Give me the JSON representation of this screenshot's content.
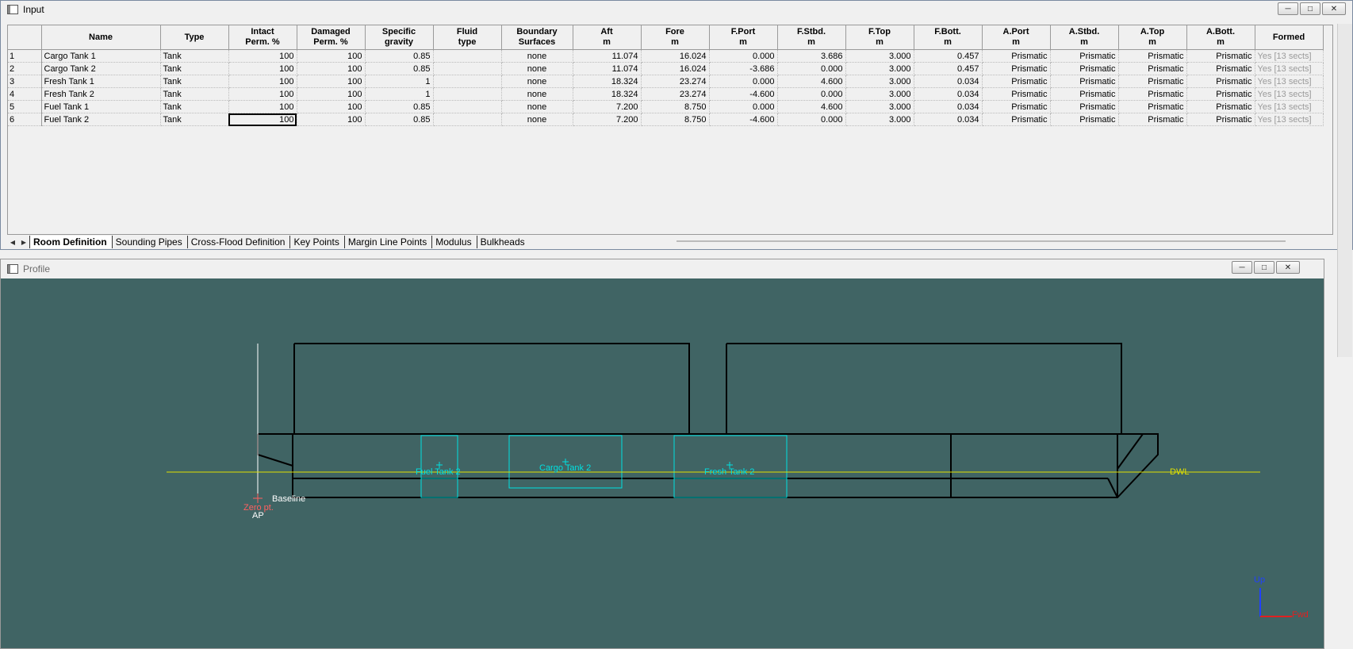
{
  "input_window": {
    "title": "Input"
  },
  "profile_window": {
    "title": "Profile"
  },
  "table": {
    "headers": [
      {
        "l1": "Name",
        "l2": ""
      },
      {
        "l1": "Type",
        "l2": ""
      },
      {
        "l1": "Intact",
        "l2": "Perm. %"
      },
      {
        "l1": "Damaged",
        "l2": "Perm. %"
      },
      {
        "l1": "Specific",
        "l2": "gravity"
      },
      {
        "l1": "Fluid",
        "l2": "type"
      },
      {
        "l1": "Boundary",
        "l2": "Surfaces"
      },
      {
        "l1": "Aft",
        "l2": "m"
      },
      {
        "l1": "Fore",
        "l2": "m"
      },
      {
        "l1": "F.Port",
        "l2": "m"
      },
      {
        "l1": "F.Stbd.",
        "l2": "m"
      },
      {
        "l1": "F.Top",
        "l2": "m"
      },
      {
        "l1": "F.Bott.",
        "l2": "m"
      },
      {
        "l1": "A.Port",
        "l2": "m"
      },
      {
        "l1": "A.Stbd.",
        "l2": "m"
      },
      {
        "l1": "A.Top",
        "l2": "m"
      },
      {
        "l1": "A.Bott.",
        "l2": "m"
      },
      {
        "l1": "Formed",
        "l2": ""
      }
    ],
    "rows": [
      [
        "1",
        "Cargo Tank 1",
        "Tank",
        "100",
        "100",
        "0.85",
        "",
        "none",
        "11.074",
        "16.024",
        "0.000",
        "3.686",
        "3.000",
        "0.457",
        "Prismatic",
        "Prismatic",
        "Prismatic",
        "Prismatic",
        "Yes [13 sects]"
      ],
      [
        "2",
        "Cargo Tank 2",
        "Tank",
        "100",
        "100",
        "0.85",
        "",
        "none",
        "11.074",
        "16.024",
        "-3.686",
        "0.000",
        "3.000",
        "0.457",
        "Prismatic",
        "Prismatic",
        "Prismatic",
        "Prismatic",
        "Yes [13 sects]"
      ],
      [
        "3",
        "Fresh Tank 1",
        "Tank",
        "100",
        "100",
        "1",
        "",
        "none",
        "18.324",
        "23.274",
        "0.000",
        "4.600",
        "3.000",
        "0.034",
        "Prismatic",
        "Prismatic",
        "Prismatic",
        "Prismatic",
        "Yes [13 sects]"
      ],
      [
        "4",
        "Fresh Tank 2",
        "Tank",
        "100",
        "100",
        "1",
        "",
        "none",
        "18.324",
        "23.274",
        "-4.600",
        "0.000",
        "3.000",
        "0.034",
        "Prismatic",
        "Prismatic",
        "Prismatic",
        "Prismatic",
        "Yes [13 sects]"
      ],
      [
        "5",
        "Fuel Tank 1",
        "Tank",
        "100",
        "100",
        "0.85",
        "",
        "none",
        "7.200",
        "8.750",
        "0.000",
        "4.600",
        "3.000",
        "0.034",
        "Prismatic",
        "Prismatic",
        "Prismatic",
        "Prismatic",
        "Yes [13 sects]"
      ],
      [
        "6",
        "Fuel Tank 2",
        "Tank",
        "100",
        "100",
        "0.85",
        "",
        "none",
        "7.200",
        "8.750",
        "-4.600",
        "0.000",
        "3.000",
        "0.034",
        "Prismatic",
        "Prismatic",
        "Prismatic",
        "Prismatic",
        "Yes [13 sects]"
      ]
    ],
    "selected_cell": {
      "row": 5,
      "col": 3
    }
  },
  "tabs": [
    {
      "label": "Room Definition",
      "active": true
    },
    {
      "label": "Sounding Pipes",
      "active": false
    },
    {
      "label": "Cross-Flood Definition",
      "active": false
    },
    {
      "label": "Key Points",
      "active": false
    },
    {
      "label": "Margin Line Points",
      "active": false
    },
    {
      "label": "Modulus",
      "active": false
    },
    {
      "label": "Bulkheads",
      "active": false
    }
  ],
  "profile": {
    "background": "#406464",
    "tank_color": "#00e0e0",
    "dwl_color": "#e0e000",
    "origin_color": "#ff6060",
    "labels": {
      "fuel_tank": "Fuel Tank 2",
      "cargo_tank": "Cargo Tank 2",
      "fresh_tank": "Fresh Tank 2",
      "dwl": "DWL",
      "baseline": "Baseline",
      "zero_pt": "Zero pt.",
      "ap": "AP",
      "axis_up": "Up",
      "axis_fwd": "Fwd"
    }
  }
}
